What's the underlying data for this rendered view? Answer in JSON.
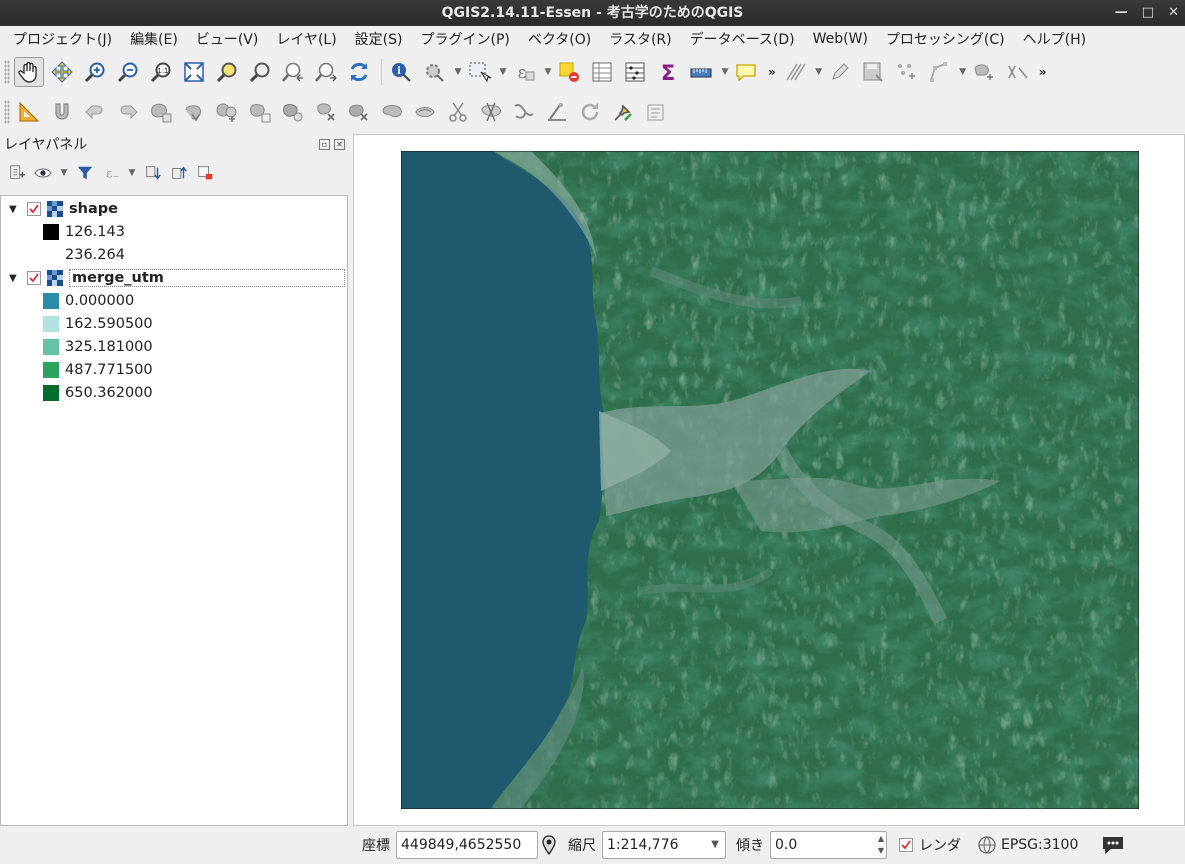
{
  "window": {
    "title": "QGIS2.14.11-Essen - 考古学のためのQGIS"
  },
  "menu": [
    "プロジェクト(J)",
    "編集(E)",
    "ビュー(V)",
    "レイヤ(L)",
    "設定(S)",
    "プラグイン(P)",
    "ベクタ(O)",
    "ラスタ(R)",
    "データベース(D)",
    "Web(W)",
    "プロセッシング(C)",
    "ヘルプ(H)"
  ],
  "toolbar": {
    "overflow": "»"
  },
  "layer_panel": {
    "title": "レイヤパネル",
    "layers": [
      {
        "name": "shape",
        "checked": true,
        "legend": [
          {
            "value": "126.143",
            "color": "#000000"
          },
          {
            "value": "236.264",
            "color": ""
          }
        ]
      },
      {
        "name": "merge_utm",
        "checked": true,
        "legend": [
          {
            "value": "0.000000",
            "color": "#2b8ca8"
          },
          {
            "value": "162.590500",
            "color": "#b2e2e2"
          },
          {
            "value": "325.181000",
            "color": "#66c2a4"
          },
          {
            "value": "487.771500",
            "color": "#2ca25f"
          },
          {
            "value": "650.362000",
            "color": "#006d2c"
          }
        ]
      }
    ]
  },
  "colors": {
    "sea": "#1f5a6e",
    "terrain_dark": "#0f3a26",
    "terrain_mid": "#2f6e4c",
    "terrain_light": "#8fb0a4"
  },
  "status": {
    "coord_label": "座標",
    "coord_value": "449849,4652550",
    "scale_label": "縮尺",
    "scale_value": "1:214,776",
    "rotation_label": "傾き",
    "rotation_value": "0.0",
    "render_label": "レンダ",
    "crs": "EPSG:3100"
  }
}
